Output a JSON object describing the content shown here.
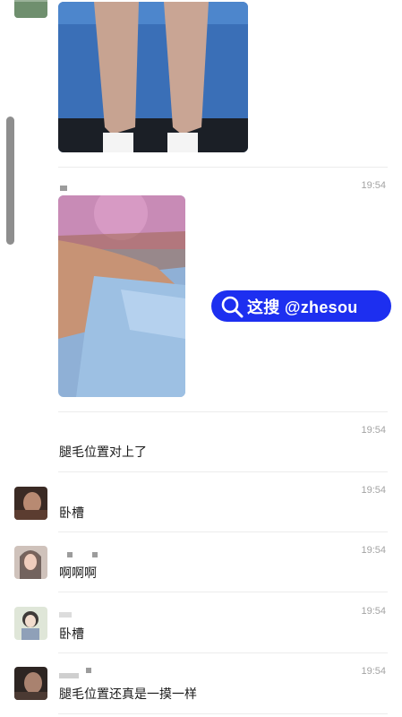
{
  "messages": [
    {
      "time": "19:54"
    },
    {
      "time": "19:54",
      "text": "腿毛位置对上了"
    },
    {
      "time": "19:54",
      "text": "卧槽"
    },
    {
      "time": "19:54",
      "text": "啊啊啊"
    },
    {
      "time": "19:54",
      "text": "卧槽"
    },
    {
      "time": "19:54",
      "text": "腿毛位置还真是一摸一样"
    }
  ],
  "watermark": {
    "text": "这搜 @zhesou",
    "icon": "search-icon"
  },
  "colors": {
    "watermark_bg": "#1d2ff0",
    "time": "#a3a3a3"
  }
}
